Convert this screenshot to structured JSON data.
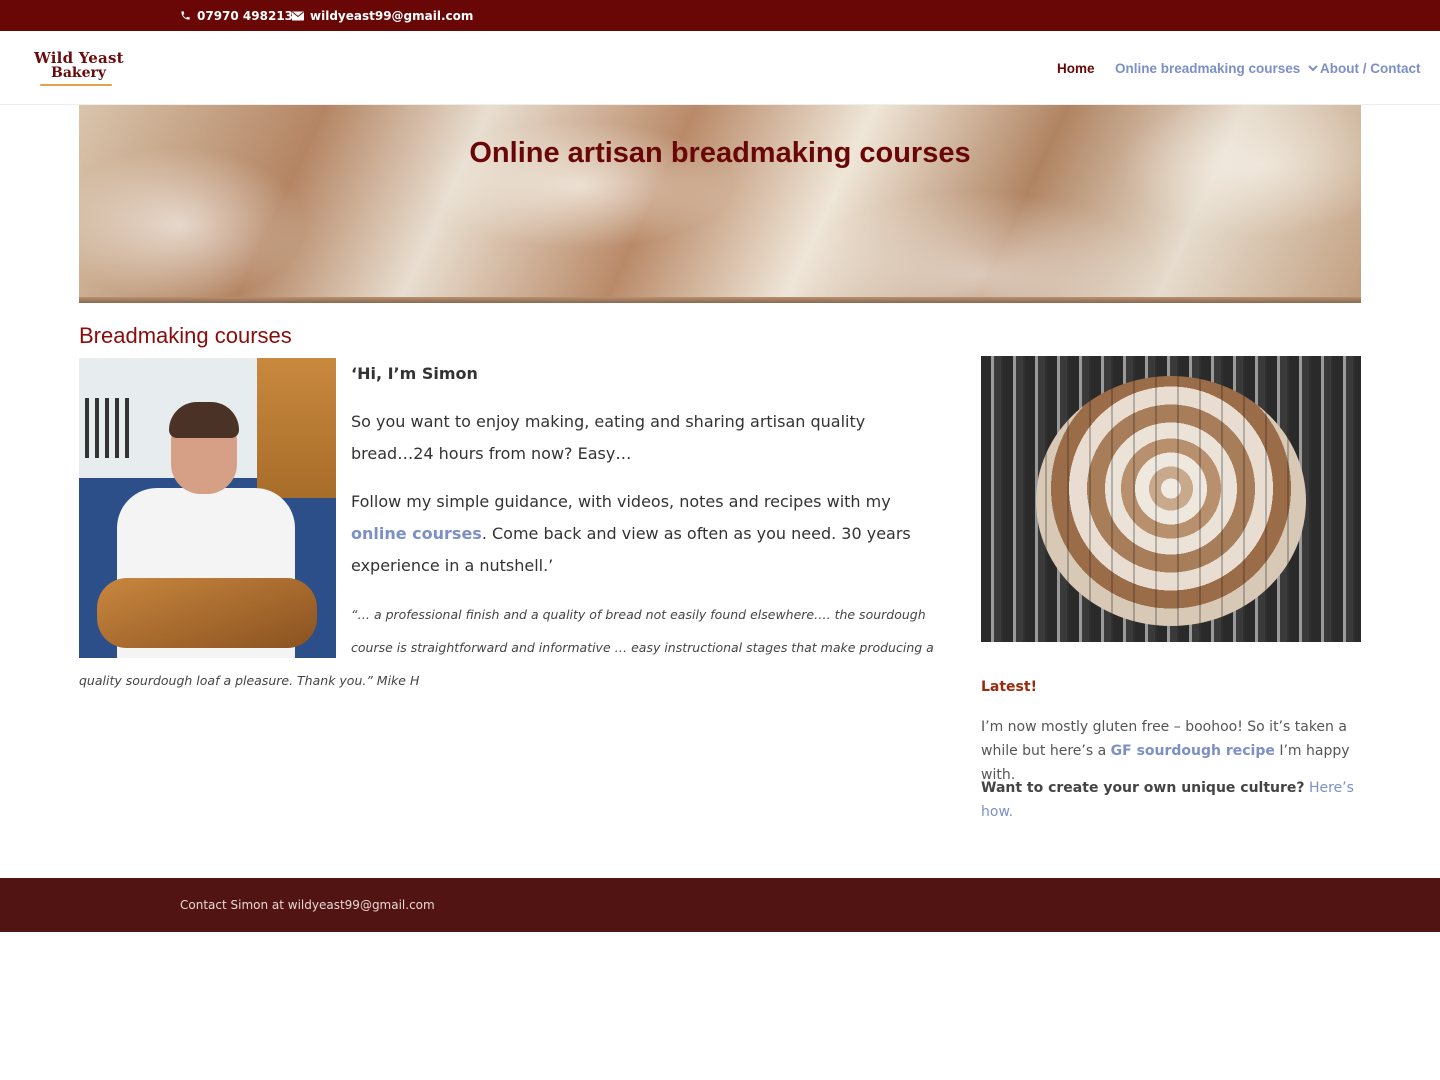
{
  "topbar": {
    "phone": "07970 498213",
    "email": "wildyeast99@gmail.com"
  },
  "logo": {
    "line1": "Wild Yeast",
    "line2": "Bakery"
  },
  "nav": {
    "home": "Home",
    "courses": "Online breadmaking courses",
    "about": "About / Contact"
  },
  "hero": {
    "title": "Online artisan breadmaking courses"
  },
  "main": {
    "section_title": "Breadmaking courses",
    "greeting": "‘Hi, I’m Simon",
    "p1": "So you want to enjoy making, eating and sharing artisan quality bread…24 hours from now? Easy…",
    "p2_before": "Follow my simple guidance, with videos, notes and recipes with my ",
    "p2_link": "online courses",
    "p2_after": ". Come back and view as often as you need. 30 years experience in a nutshell.’",
    "quote_line1": "“… a professional finish and a quality of bread not easily found elsewhere…. the sourdough",
    "quote_line2": "course is straightforward and informative … easy instructional stages that make producing a",
    "quote_line3": "quality sourdough loaf a pleasure. Thank you.”  Mike H"
  },
  "sidebar": {
    "latest": "Latest!",
    "p1_before": "I’m now mostly gluten free – boohoo! So it’s taken a while but here’s a ",
    "p1_link": "GF sourdough recipe",
    "p1_after": " I’m happy with.",
    "p2_strong": "Want to create your own unique culture?",
    "p2_link": "Here’s how."
  },
  "footer": {
    "text": "Contact Simon at wildyeast99@gmail.com"
  },
  "colors": {
    "topbar": "#690707",
    "accent_link": "#7c8fc7",
    "heading_red": "#8a0c0c",
    "footer": "#521412"
  }
}
